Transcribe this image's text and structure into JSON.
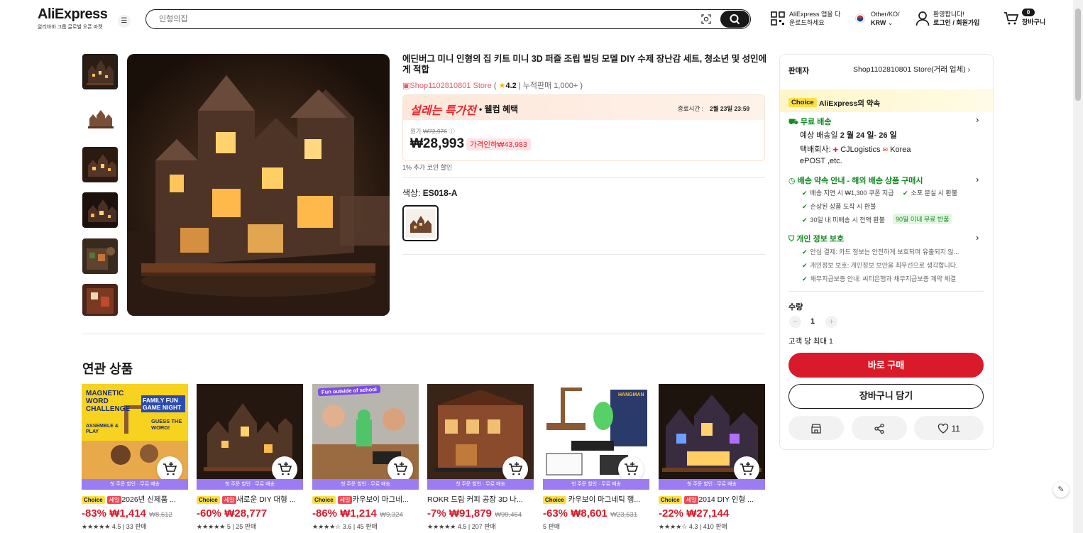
{
  "header": {
    "logo": "AliExpress",
    "logo_sub": "알리바바 그룹 글로벌 오픈 마켓",
    "search_placeholder": "인형의집",
    "app_line1": "AliExpress 앱을 다",
    "app_line2": "운로드하세요",
    "locale_line1": "Other/KO/",
    "locale_line2": "KRW",
    "account_line1": "환영합니다!",
    "account_line2": "로그인 / 회원가입",
    "cart_count": "0",
    "cart_label": "장바구니"
  },
  "product": {
    "title": "에딘버그 미니 인형의 집 키트 미니 3D 퍼즐 조립 빌딩 모델 DIY 수제 장난감 세트, 청소년 및 성인에게 적합",
    "store": "Shop1102810801 Store",
    "rating": "4.2",
    "sold": "누적판매 1,000+",
    "promo_title": "설레는 특가전",
    "promo_sub": "• 웰컴 혜택",
    "end_label": "종료시간 :",
    "end_time": "2월 23일 23:59",
    "orig_label": "원가",
    "orig_price": "₩72,976",
    "price": "₩28,993",
    "discount_badge": "가격인하₩43,983",
    "coin_note": "1% 추가 코인 할인",
    "color_label": "색상: ",
    "color_value": "ES018-A"
  },
  "side": {
    "seller_label": "판매자",
    "seller_name": "Shop1102810801 Store(거래 업체)",
    "choice_badge": "Choice",
    "promise": "AliExpress의 약속",
    "free_ship": "무료 배송",
    "eta_prefix": "예상 배송일",
    "eta": "2 월 24 일- 26 일",
    "carrier_prefix": "택배회사:",
    "carrier1": "CJLogistics",
    "carrier2": "Korea",
    "carrier3": "ePOST ,etc.",
    "guarantee_title": "배송 약속 안내 - 해외 배송 상품 구매시",
    "g1": "배송 지연 시 ₩1,300 쿠폰 지급",
    "g2": "소포 분실 시 환불",
    "g3": "손상된 상품 도착 시 환불",
    "g4": "30일 내 미배송 시 전액 환불",
    "g4_badge": "90일 이내 무료 반품",
    "privacy_title": "개인 정보 보호",
    "p1": "안심 결제: 카드 정보는 안전하게 보호되며 유출되지 않...",
    "p2": "개인정보 보호: 개인정보 보안을 최우선으로 생각합니다.",
    "p3": "채무지급보증 안내: 씨티은행과 채무지급보증 계약 체결",
    "qty_label": "수량",
    "qty_value": "1",
    "qty_limit": "고객 당 최대 1",
    "buy_now": "바로 구매",
    "add_cart": "장바구니 담기",
    "wish_count": "11"
  },
  "related": {
    "title": "연관 상품",
    "strip": "첫 주문 할인 · 무료 배송",
    "items": [
      {
        "choice": "Choice",
        "sale": "세일",
        "name": "2026년 신제품 ...",
        "disc": "-83%",
        "price": "₩1,414",
        "orig": "₩8,512",
        "rating": "4.5",
        "sold": "33 판매"
      },
      {
        "choice": "Choice",
        "sale": "세일",
        "name": "새로운 DIY 대형 ...",
        "disc": "-60%",
        "price": "₩28,777",
        "orig": "",
        "rating": "5",
        "sold": "25 판매"
      },
      {
        "choice": "Choice",
        "sale": "세일",
        "name": "카우보이 마그네...",
        "disc": "-86%",
        "price": "₩1,214",
        "orig": "₩9,324",
        "rating": "3.6",
        "sold": "45 판매"
      },
      {
        "choice": "",
        "sale": "",
        "name": "ROKR 드림 커피 공장 3D 나...",
        "disc": "-7%",
        "price": "₩91,879",
        "orig": "₩99,464",
        "rating": "4.5",
        "sold": "207 판매"
      },
      {
        "choice": "Choice",
        "sale": "",
        "name": "카우보이 마그네틱 행...",
        "disc": "-63%",
        "price": "₩8,601",
        "orig": "₩23,531",
        "rating": "",
        "sold": "5 판매"
      },
      {
        "choice": "Choice",
        "sale": "세일",
        "name": "2014 DIY 인형 ...",
        "disc": "-22%",
        "price": "₩27,144",
        "orig": "",
        "rating": "4.3",
        "sold": "410 판매"
      }
    ]
  },
  "product_image_texts": {
    "p1_a": "MAGNETIC WORD CHALLENGE",
    "p1_b": "ASSEMBLE & PLAY",
    "p1_c": "FAMILY FUN GAME NIGHT",
    "p1_d": "GUESS THE WORD!",
    "p3_a": "Fun outside of school",
    "p5_a": "HANGMAN"
  },
  "colors": {
    "accent": "#d91a2a",
    "choice": "#fde047",
    "strip": "#9b7cf3",
    "green": "#128b21"
  }
}
